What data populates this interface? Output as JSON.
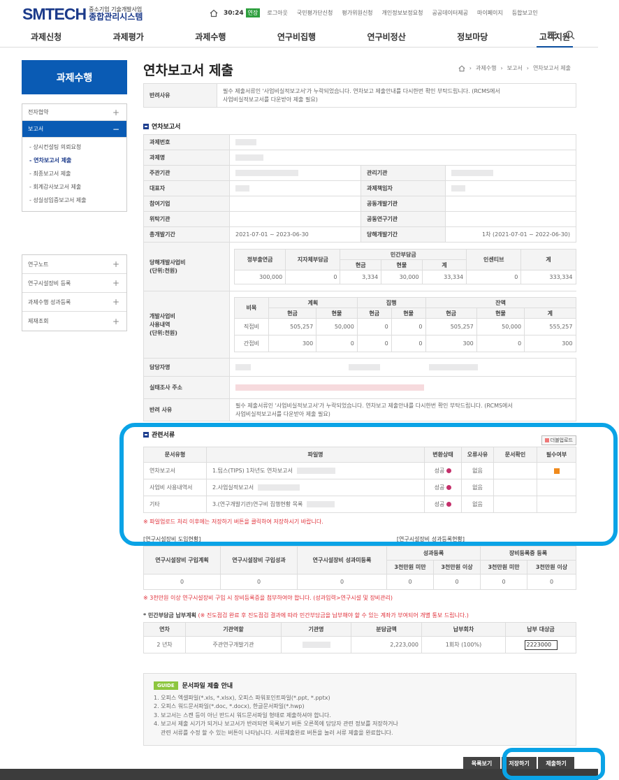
{
  "header": {
    "logo_main": "SMTECH",
    "logo_sub1": "중소기업 기술개발사업",
    "logo_sub2": "종합관리시스템",
    "timer": "30:24",
    "extend": "연장",
    "top_links": [
      "로그아웃",
      "국민평가단신청",
      "평가위원신청",
      "개인정보보정요청",
      "공공데이터제공",
      "마이페이지",
      "등합보고인"
    ],
    "gnb": [
      "과제신청",
      "과제평가",
      "과제수행",
      "연구비집행",
      "연구비정산",
      "정보마당",
      "고객지원"
    ]
  },
  "lnb": {
    "title": "과제수행",
    "group1": {
      "row1": "전자협약",
      "row2": "보고서"
    },
    "subs": [
      "상시컨설팅 의뢰요청",
      "연차보고서 제출",
      "최종보고서 제출",
      "회계감사보고서 제출",
      "성실성입증보고서 제출"
    ],
    "group2": [
      "연구노트",
      "연구시설장비 등록",
      "과제수행 성과등록",
      "제재조회"
    ]
  },
  "page": {
    "title": "연차보고서 제출",
    "breadcrumb": [
      "과제수행",
      "보고서",
      "연차보고서 제출"
    ]
  },
  "reject": {
    "label": "반려사유",
    "text1": "필수 제출서류인 '사업비실적보고서'가 누락되었습니다. 연차보고 제출안내를 다시한번 확인 부탁드립니다. (RCMS에서",
    "text2": "사업비실적보고서를 다운받아 제출 필요)"
  },
  "annual": {
    "section": "연차보고서",
    "labels": {
      "no": "과제번호",
      "name": "과제명",
      "lead": "주관기관",
      "manage": "관리기관",
      "rep": "대표자",
      "pm": "과제책임자",
      "join": "참여기업",
      "codev": "공동개발기관",
      "consign": "위탁기관",
      "coresearch": "공동연구기관",
      "total_period": "총개발기간",
      "year_period": "당해개발기간"
    },
    "total_period": "2021-07-01 ~ 2023-06-30",
    "year_period": "1차 (2021-07-01 ~ 2022-06-30)",
    "budget": {
      "label1": "당해개발사업비",
      "label2": "(단위:천원)",
      "h_gov": "정부출연금",
      "h_local": "지자체부담금",
      "h_private": "민간부담금",
      "h_incentive": "인센티브",
      "h_total": "계",
      "h_cash": "현금",
      "h_kind": "현물",
      "h_sum": "계",
      "v_gov": "300,000",
      "v_local": "0",
      "v_cash": "3,334",
      "v_kind": "30,000",
      "v_sum": "33,334",
      "v_incentive": "0",
      "v_total": "333,334"
    },
    "usage": {
      "label1": "개발사업비",
      "label2": "사용내역",
      "label3": "(단위:천원)",
      "h_item": "비목",
      "h_plan": "계획",
      "h_exec": "집행",
      "h_remain": "잔액",
      "h_cash": "현금",
      "h_kind": "현물",
      "h_sum": "계",
      "rows": [
        {
          "item": "직접비",
          "pc": "505,257",
          "pk": "50,000",
          "ec": "0",
          "ek": "0",
          "rc": "505,257",
          "rk": "50,000",
          "rs": "555,257"
        },
        {
          "item": "간접비",
          "pc": "300",
          "pk": "0",
          "ec": "0",
          "ek": "0",
          "rc": "300",
          "rk": "0",
          "rs": "300"
        }
      ]
    },
    "manager": "담당자명",
    "inspect_addr": "실태조사 주소",
    "reject_label": "반려 사유",
    "reject_text1": "필수 제출서류인 '사업비실적보고서'가 누락되었습니다. 연차보고 제출안내를 다시한번 확인 부탁드립니다. (RCMS에서",
    "reject_text2": "사업비실적보고서를 다운받아 제출 필요)"
  },
  "docs": {
    "section": "관련서류",
    "download_btn": "더블업로드",
    "headers": [
      "문서유형",
      "파일명",
      "변환상태",
      "오류사유",
      "문서확인",
      "필수여부"
    ],
    "rows": [
      {
        "type": "연차보고서",
        "file": "1.팁스(TIPS) 1차년도 연차보고서",
        "status": "성공",
        "err": "없음"
      },
      {
        "type": "사업비 사용내역서",
        "file": "2.사업실적보고서",
        "status": "성공",
        "err": "없음"
      },
      {
        "type": "기타",
        "file": "3.(연구개발기관)연구비 집행현황 목록",
        "status": "성공",
        "err": "없음"
      }
    ],
    "notice": "※ 파일업로드 처리 이후에는 저장하기 버튼을 클릭하여 저장하시기 바랍니다."
  },
  "equip": {
    "left_caption": "[연구시설장비 도입현황]",
    "right_caption": "[연구시설장비 성과등록현황]",
    "h_plan": "연구시설장비 구입계획",
    "h_result": "연구시설장비 구입성과",
    "h_unreg": "연구시설장비 성과미등록",
    "h_perf": "성과등록",
    "h_equipreg": "장비등록증 등록",
    "h_under": "3천만원 미만",
    "h_over": "3천만원 이상",
    "values": [
      "0",
      "0",
      "0",
      "0",
      "0",
      "0",
      "0"
    ],
    "notice": "※ 3천만원 이상 연구시설장비 구입 시 장비등록증을 첨부하여야 합니다. (성과입력>연구시설 및 장비관리)"
  },
  "payment": {
    "title": "* 민간부담금 납부계획",
    "title_note": "(※ 진도점검 완료 후 진도점검 결과에 따라 민간부담금을 납부해야 할 수 있는 계좌가 부여되어 개별 통보 드립니다.)",
    "headers": [
      "연차",
      "기관역할",
      "기관명",
      "분담금액",
      "납부회차",
      "납부 대상금"
    ],
    "row": {
      "year": "2 년차",
      "role": "주관연구개발기관",
      "amount": "2,223,000",
      "round": "1회차 (100%)",
      "target": "2223000"
    }
  },
  "guide": {
    "badge": "GUIDE",
    "title": "문서파일 제출 안내",
    "lines": [
      "1. 오피스 엑셀파일(*.xls, *.xlsx), 오피스 파워포인트파일(*.ppt, *.pptx)",
      "2. 오피스 워드문서파일(*.doc, *.docx), 한글문서파일(*.hwp)",
      "3. 보고서는 스캔 등이 아닌 반드시 워드문서파일 형태로 제출하셔야 합니다.",
      "4. 보고서 제출 시기가 되거나 보고서가 반려되면 목록보기 버튼 오른쪽에 담당자 관련 정보를 저장하거나",
      "관련 서류를 수정 할 수 있는 버튼이 나타납니다. 서류제출완료 버튼을 눌러 서류 제출을 완료합니다."
    ]
  },
  "buttons": {
    "list": "목록보기",
    "save": "저장하기",
    "submit": "제출하기"
  },
  "highlight_color": "#0aa3e6"
}
